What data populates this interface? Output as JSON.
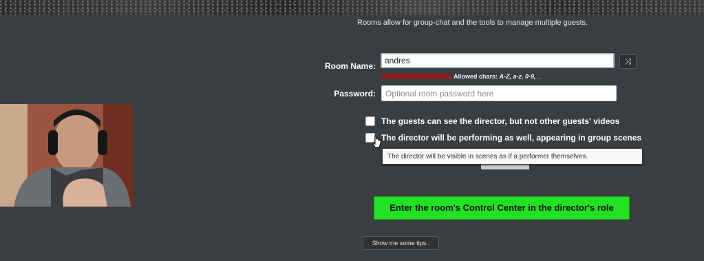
{
  "intro": "Rooms allow for group-chat and the tools to manage multiple guests.",
  "room": {
    "label": "Room Name:",
    "value": "andres",
    "shuffle_icon": "shuffle-icon",
    "allowed_prefix": "Allowed chars:",
    "allowed_chars": "A-Z, a-z, 0-9, _"
  },
  "password": {
    "label": "Password:",
    "placeholder": "Optional room password here"
  },
  "options": {
    "guests_see_director": "The guests can see the director, but not other guests' videos",
    "director_performing": "The director will be performing as well, appearing in group scenes"
  },
  "tooltip": "The director will be visible in scenes as if a performer themselves.",
  "control_center_button": "Enter the room's Control Center in the director's role",
  "tips_button": "Show me some tips.."
}
